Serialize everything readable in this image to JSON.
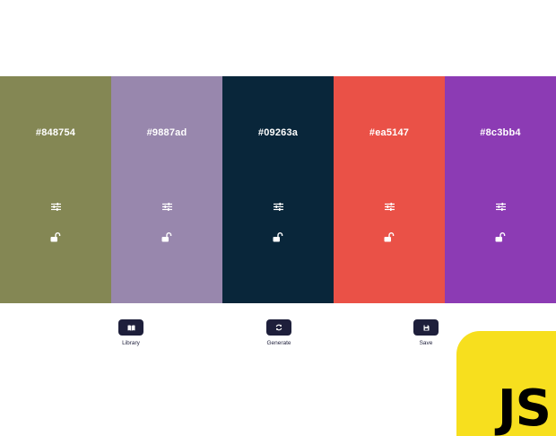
{
  "palette": {
    "swatches": [
      {
        "hex": "#848754",
        "color": "#848754"
      },
      {
        "hex": "#9887ad",
        "color": "#9887ad"
      },
      {
        "hex": "#09263a",
        "color": "#09263a"
      },
      {
        "hex": "#ea5147",
        "color": "#ea5147"
      },
      {
        "hex": "#8c3bb4",
        "color": "#8c3bb4"
      }
    ],
    "swatch_icons": {
      "adjust": "sliders-icon",
      "lock": "unlock-icon"
    }
  },
  "toolbar": {
    "library": {
      "label": "Library",
      "icon": "book-icon"
    },
    "generate": {
      "label": "Generate",
      "icon": "refresh-icon"
    },
    "save": {
      "label": "Save",
      "icon": "floppy-disk-icon"
    }
  },
  "badge": {
    "text": "JS",
    "color": "#f7df1e"
  },
  "colors": {
    "button_bg": "#1e1f3b",
    "background": "#ffffff"
  }
}
